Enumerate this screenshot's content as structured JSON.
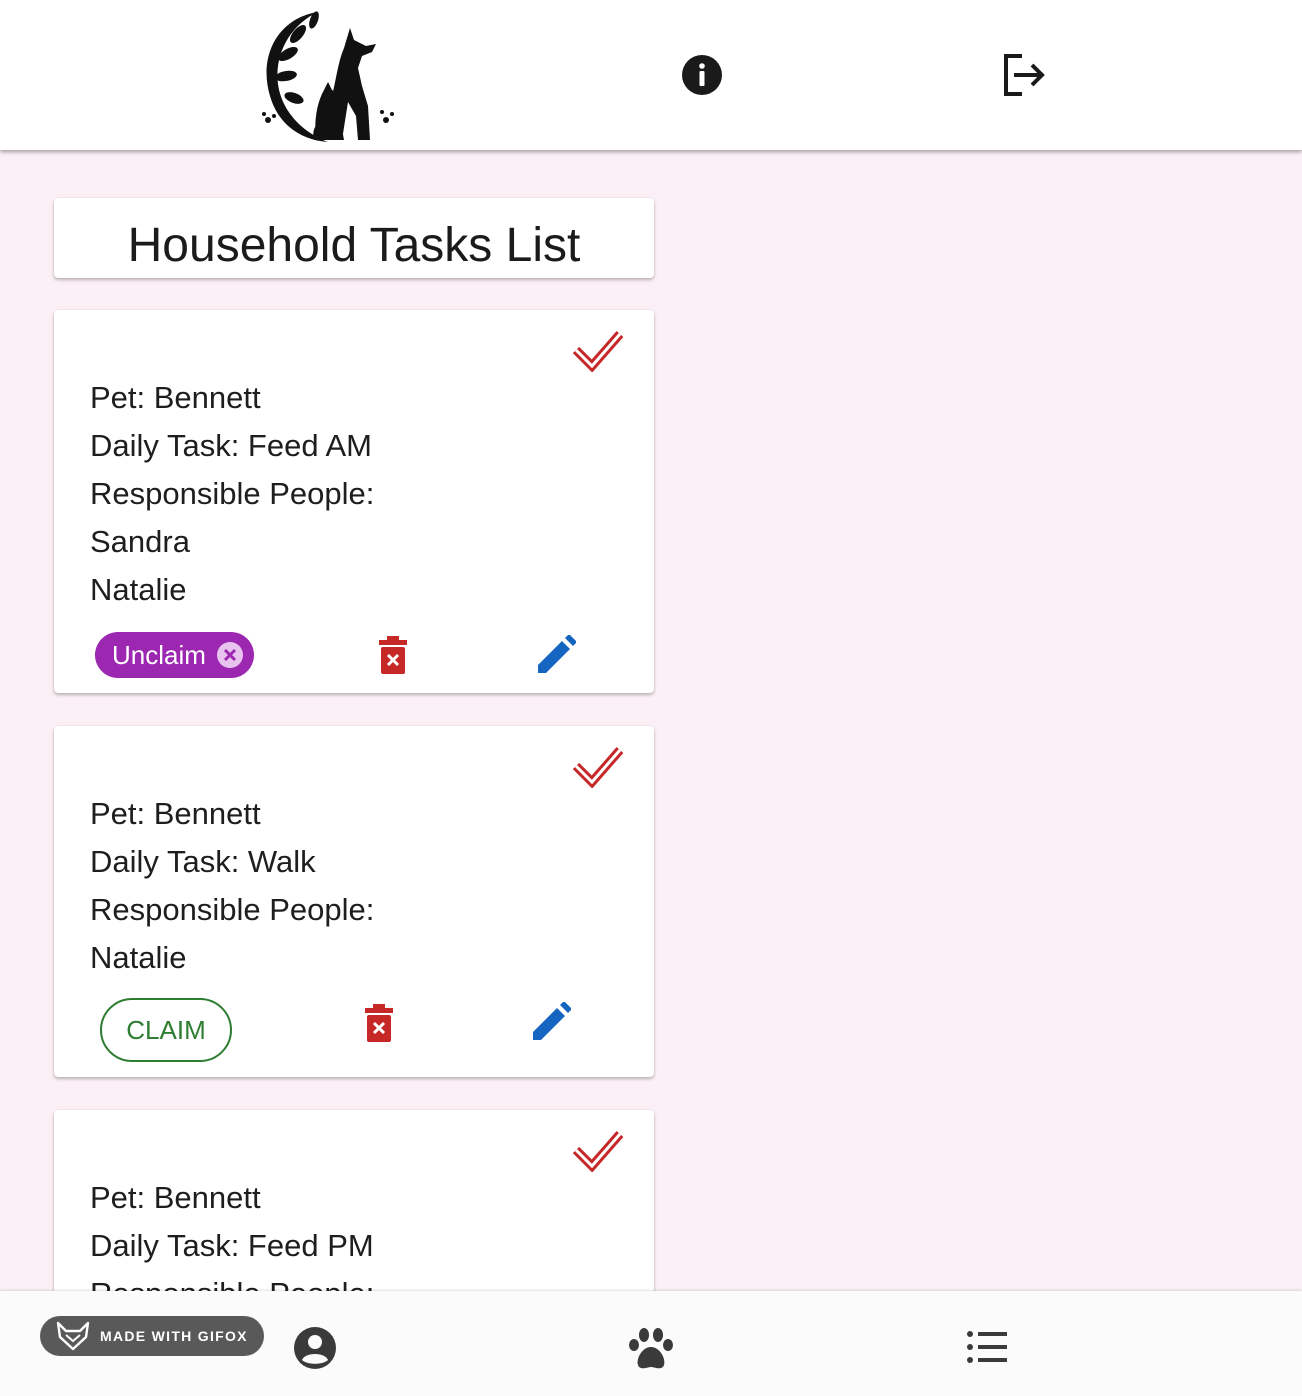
{
  "header": {
    "info_icon": "info-icon",
    "logout_icon": "logout-icon",
    "logo_icon": "cat-dog-logo"
  },
  "page": {
    "title": "Household Tasks List"
  },
  "tasks": [
    {
      "pet": "Pet: Bennett",
      "task": "Daily Task: Feed AM",
      "responsible_label": "Responsible People:",
      "people": [
        "Sandra",
        "Natalie"
      ],
      "claim_state": "Unclaim"
    },
    {
      "pet": "Pet: Bennett",
      "task": "Daily Task: Walk",
      "responsible_label": "Responsible People:",
      "people": [
        "Natalie"
      ],
      "claim_state": "CLAIM"
    },
    {
      "pet": "Pet: Bennett",
      "task": "Daily Task: Feed PM",
      "responsible_label": "Responsible People:",
      "people": []
    }
  ],
  "bottom_nav": {
    "badge": "MADE WITH GIFOX",
    "items": [
      "profile-icon",
      "paw-icon",
      "list-icon"
    ]
  },
  "colors": {
    "background": "#fbf0f5",
    "check": "#c62828",
    "trash": "#c62828",
    "pencil": "#1565c0",
    "unclaim_chip": "#9c27b0",
    "claim_outline": "#2e7d32"
  }
}
